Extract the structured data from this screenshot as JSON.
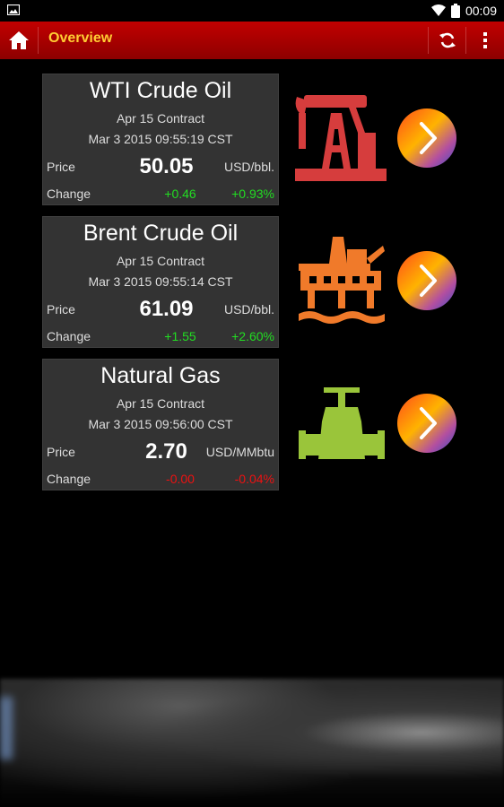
{
  "status_bar": {
    "time": "00:09"
  },
  "app_bar": {
    "title": "Overview"
  },
  "colors": {
    "up": "#22dd22",
    "down": "#ee1111",
    "title": "#ffcc33"
  },
  "commodities": [
    {
      "name": "WTI Crude Oil",
      "contract": "Apr 15 Contract",
      "timestamp": "Mar 3 2015 09:55:19 CST",
      "price_label": "Price",
      "price": "50.05",
      "unit": "USD/bbl.",
      "change_label": "Change",
      "change": "+0.46",
      "change_pct": "+0.93%",
      "icon": "oil-pumpjack-icon"
    },
    {
      "name": "Brent Crude Oil",
      "contract": "Apr 15 Contract",
      "timestamp": "Mar 3 2015 09:55:14 CST",
      "price_label": "Price",
      "price": "61.09",
      "unit": "USD/bbl.",
      "change_label": "Change",
      "change": "+1.55",
      "change_pct": "+2.60%",
      "icon": "offshore-rig-icon"
    },
    {
      "name": "Natural Gas",
      "contract": "Apr 15 Contract",
      "timestamp": "Mar 3 2015 09:56:00 CST",
      "price_label": "Price",
      "price": "2.70",
      "unit": "USD/MMbtu",
      "change_label": "Change",
      "change": "-0.00",
      "change_pct": "-0.04%",
      "icon": "gas-valve-pipe-icon"
    }
  ]
}
